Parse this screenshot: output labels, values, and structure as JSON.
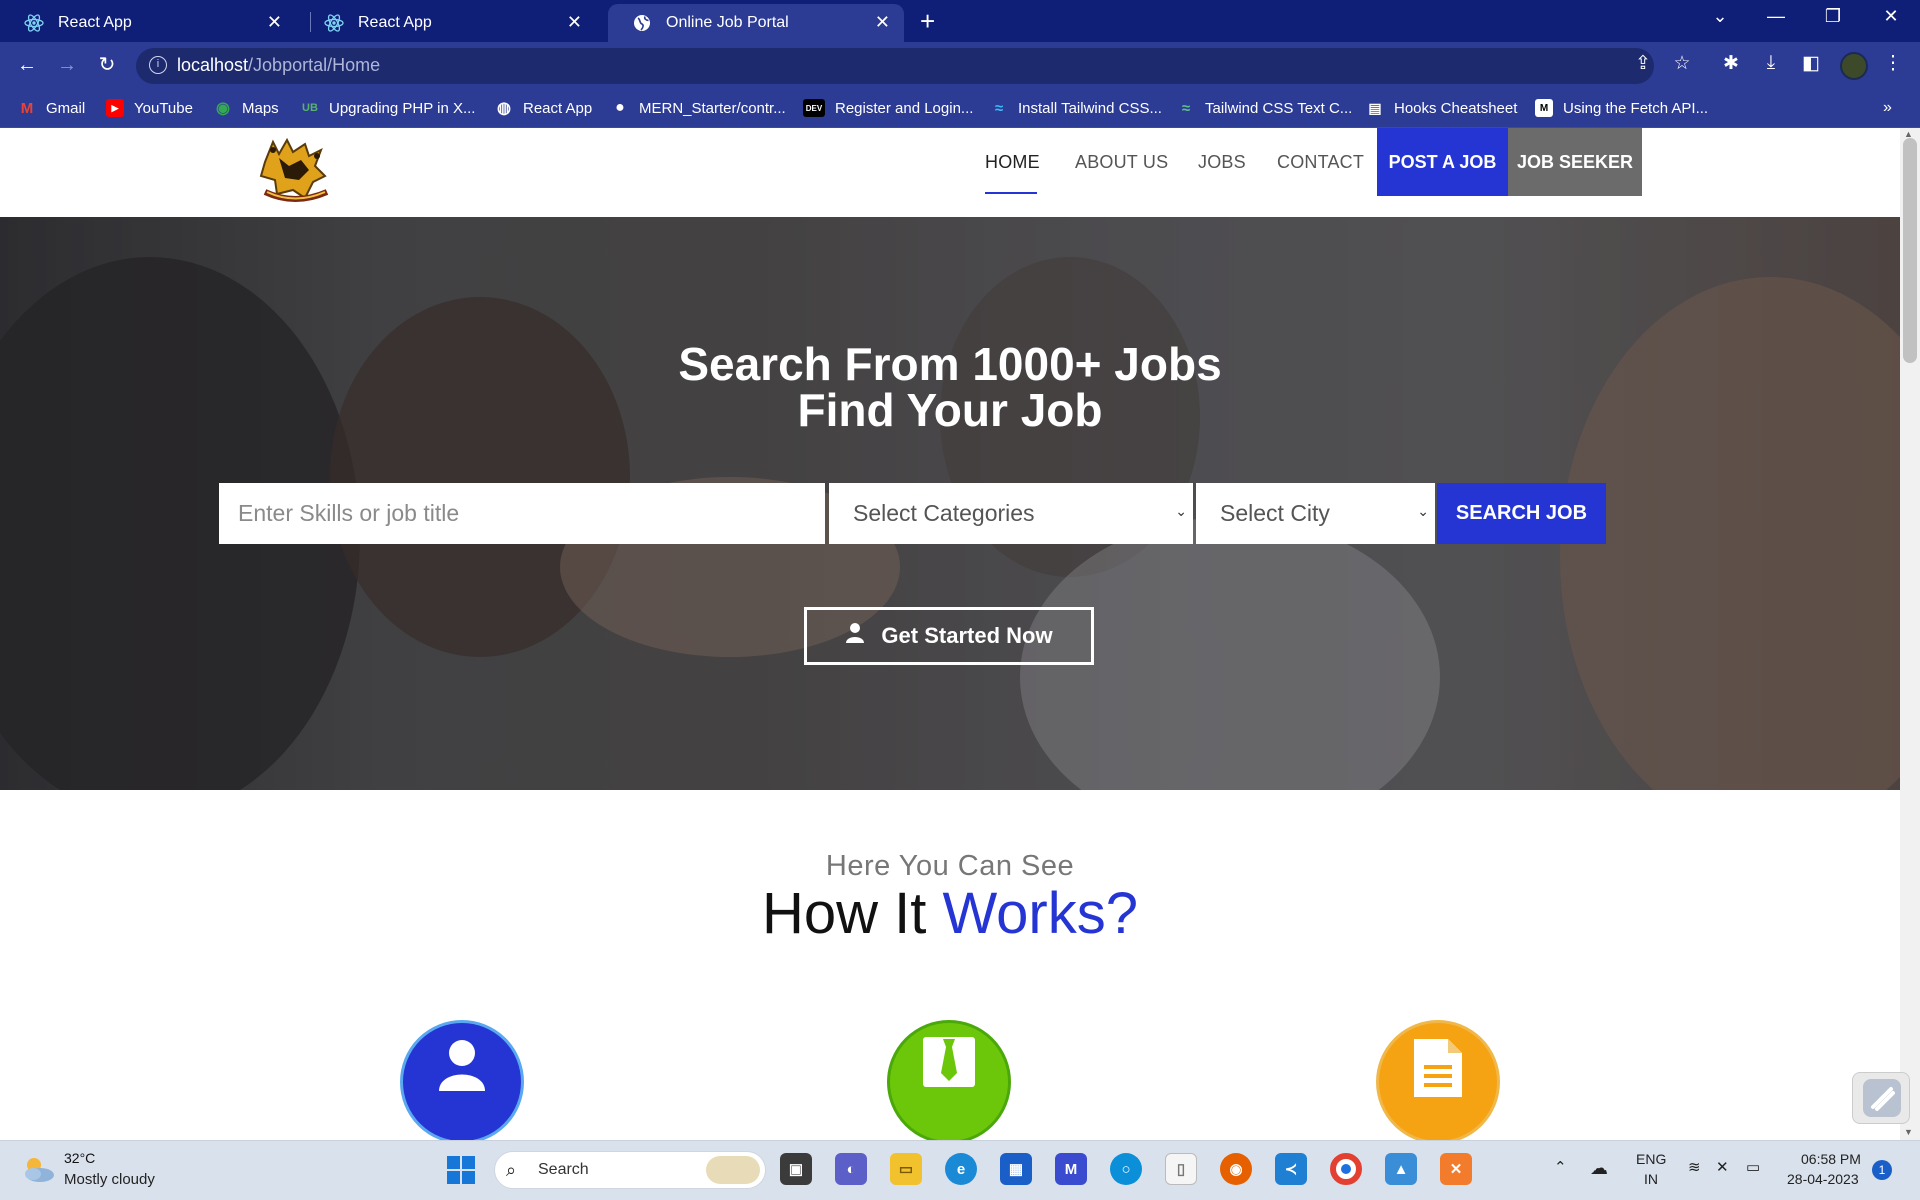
{
  "browser": {
    "tabs": [
      {
        "title": "React App",
        "icon": "react-icon"
      },
      {
        "title": "React App",
        "icon": "react-icon"
      },
      {
        "title": "Online Job Portal",
        "icon": "globe-icon",
        "active": true
      }
    ],
    "url_host": "localhost",
    "url_path": "/Jobportal/Home",
    "bookmarks": [
      "Gmail",
      "YouTube",
      "Maps",
      "Upgrading PHP in X...",
      "React App",
      "MERN_Starter/contr...",
      "Register and Login...",
      "Install Tailwind CSS...",
      "Tailwind CSS Text C...",
      "Hooks Cheatsheet",
      "Using the Fetch API..."
    ],
    "bookmark_dev_badge": "DEV",
    "more_bookmarks": "»"
  },
  "nav": {
    "home": "HOME",
    "about": "ABOUT US",
    "jobs": "JOBS",
    "contact": "CONTACT",
    "post_job": "POST A JOB",
    "job_seeker": "JOB SEEKER"
  },
  "hero": {
    "title_line1": "Search From 1000+ Jobs",
    "title_line2": "Find Your Job",
    "search_placeholder": "Enter Skills or job title",
    "category_select": "Select Categories",
    "city_select": "Select City",
    "search_button": "SEARCH JOB",
    "cta_button": "Get Started Now"
  },
  "how_it_works": {
    "subtitle": "Here You Can See",
    "title_part1": "How It ",
    "title_accent": "Works?",
    "steps": [
      {
        "icon": "user-icon",
        "color": "#2535d4"
      },
      {
        "icon": "tie-icon",
        "color": "#6cc70a"
      },
      {
        "icon": "document-icon",
        "color": "#f6a313"
      }
    ]
  },
  "taskbar": {
    "temperature": "32°C",
    "weather": "Mostly cloudy",
    "search_label": "Search",
    "lang_line1": "ENG",
    "lang_line2": "IN",
    "time": "06:58 PM",
    "date": "28-04-2023",
    "notifications": "1"
  },
  "colors": {
    "accent": "#2535d4",
    "browser_frame": "#2c3b94",
    "job_seeker_bg": "#6b6b6b"
  }
}
